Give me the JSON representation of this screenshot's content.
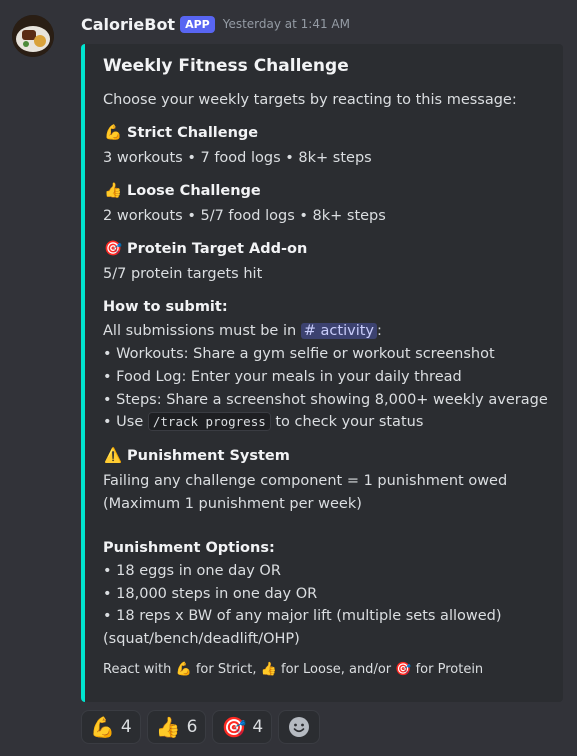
{
  "bot": {
    "name": "CalorieBot",
    "badge": "APP",
    "timestamp": "Yesterday at 1:41 AM",
    "avatar_icon": "food-plate-icon"
  },
  "embed": {
    "accent_color": "#00e5d0",
    "title": "Weekly Fitness Challenge",
    "intro": "Choose your weekly targets by reacting to this message:",
    "strict": {
      "emoji": "💪",
      "title": "Strict Challenge",
      "desc": "3 workouts • 7 food logs • 8k+ steps"
    },
    "loose": {
      "emoji": "👍",
      "title": "Loose Challenge",
      "desc": "2 workouts • 5/7 food logs • 8k+ steps"
    },
    "protein": {
      "emoji": "🎯",
      "title": "Protein Target Add-on",
      "desc": "5/7 protein targets hit"
    },
    "submit": {
      "title": "How to submit:",
      "intro_prefix": "All submissions must be in",
      "channel": "# activity",
      "intro_suffix": ":",
      "items": [
        "• Workouts: Share a gym selfie or workout screenshot",
        "• Food Log: Enter your meals in your daily thread",
        "• Steps: Share a screenshot showing 8,000+ weekly average"
      ],
      "use_prefix": "• Use",
      "command": "/track progress",
      "use_suffix": "to check your status"
    },
    "punishment": {
      "emoji": "⚠️",
      "title": "Punishment System",
      "line1": "Failing any challenge component = 1 punishment owed",
      "line2": "(Maximum 1 punishment per week)"
    },
    "options": {
      "title": "Punishment Options:",
      "items": [
        "• 18 eggs in one day OR",
        "• 18,000 steps in one day OR",
        "• 18 reps x BW of any major lift (multiple sets allowed)",
        "(squat/bench/deadlift/OHP)"
      ]
    },
    "footer": {
      "p1": "React with",
      "e1": "💪",
      "p2": "for Strict,",
      "e2": "👍",
      "p3": "for Loose, and/or",
      "e3": "🎯",
      "p4": "for Protein"
    }
  },
  "reactions": [
    {
      "emoji": "💪",
      "count": "4"
    },
    {
      "emoji": "👍",
      "count": "6"
    },
    {
      "emoji": "🎯",
      "count": "4"
    }
  ],
  "add_reaction_icon": "smiley-add-reaction-icon"
}
